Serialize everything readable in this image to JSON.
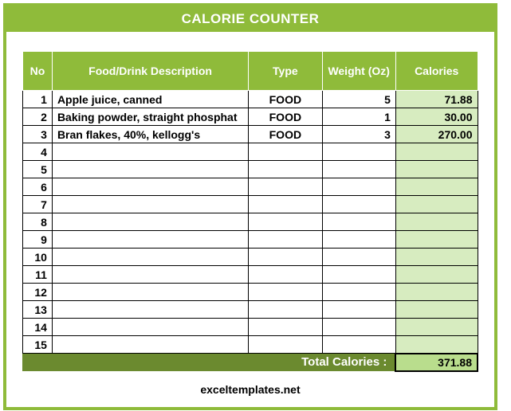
{
  "title": "CALORIE COUNTER",
  "headers": {
    "no": "No",
    "desc": "Food/Drink Description",
    "type": "Type",
    "weight": "Weight (Oz)",
    "calories": "Calories"
  },
  "rows": [
    {
      "no": "1",
      "desc": "Apple juice, canned",
      "type": "FOOD",
      "weight": "5",
      "cal": "71.88"
    },
    {
      "no": "2",
      "desc": "Baking powder, straight phosphat",
      "type": "FOOD",
      "weight": "1",
      "cal": "30.00"
    },
    {
      "no": "3",
      "desc": "Bran flakes, 40%, kellogg's",
      "type": "FOOD",
      "weight": "3",
      "cal": "270.00"
    },
    {
      "no": "4",
      "desc": "",
      "type": "",
      "weight": "",
      "cal": ""
    },
    {
      "no": "5",
      "desc": "",
      "type": "",
      "weight": "",
      "cal": ""
    },
    {
      "no": "6",
      "desc": "",
      "type": "",
      "weight": "",
      "cal": ""
    },
    {
      "no": "7",
      "desc": "",
      "type": "",
      "weight": "",
      "cal": ""
    },
    {
      "no": "8",
      "desc": "",
      "type": "",
      "weight": "",
      "cal": ""
    },
    {
      "no": "9",
      "desc": "",
      "type": "",
      "weight": "",
      "cal": ""
    },
    {
      "no": "10",
      "desc": "",
      "type": "",
      "weight": "",
      "cal": ""
    },
    {
      "no": "11",
      "desc": "",
      "type": "",
      "weight": "",
      "cal": ""
    },
    {
      "no": "12",
      "desc": "",
      "type": "",
      "weight": "",
      "cal": ""
    },
    {
      "no": "13",
      "desc": "",
      "type": "",
      "weight": "",
      "cal": ""
    },
    {
      "no": "14",
      "desc": "",
      "type": "",
      "weight": "",
      "cal": ""
    },
    {
      "no": "15",
      "desc": "",
      "type": "",
      "weight": "",
      "cal": ""
    }
  ],
  "total_label": "Total Calories :",
  "total_value": "371.88",
  "footer": "exceltemplates.net",
  "chart_data": {
    "type": "table",
    "title": "CALORIE COUNTER",
    "columns": [
      "No",
      "Food/Drink Description",
      "Type",
      "Weight (Oz)",
      "Calories"
    ],
    "rows": [
      [
        1,
        "Apple juice, canned",
        "FOOD",
        5,
        71.88
      ],
      [
        2,
        "Baking powder, straight phosphat",
        "FOOD",
        1,
        30.0
      ],
      [
        3,
        "Bran flakes, 40%, kellogg's",
        "FOOD",
        3,
        270.0
      ]
    ],
    "total_calories": 371.88
  }
}
